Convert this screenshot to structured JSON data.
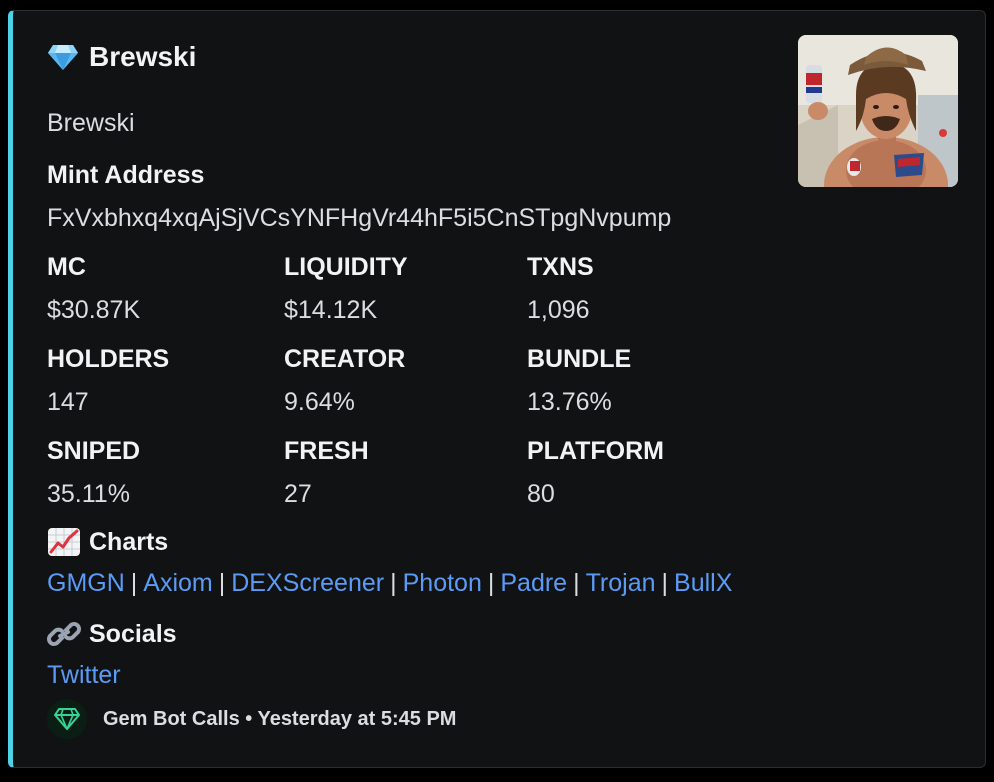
{
  "embed": {
    "accent_color": "#4fd1e8",
    "title_icon": "gem-icon",
    "title": "Brewski",
    "subtitle": "Brewski",
    "mint": {
      "label": "Mint Address",
      "value": "FxVxbhxq4xqAjSjVCsYNFHgVr44hF5i5CnSTpgNvpump"
    },
    "stats": [
      {
        "label": "MC",
        "value": "$30.87K"
      },
      {
        "label": "LIQUIDITY",
        "value": "$14.12K"
      },
      {
        "label": "TXNS",
        "value": "1,096"
      },
      {
        "label": "HOLDERS",
        "value": "147"
      },
      {
        "label": "CREATOR",
        "value": "9.64%"
      },
      {
        "label": "BUNDLE",
        "value": "13.76%"
      },
      {
        "label": "SNIPED",
        "value": "35.11%"
      },
      {
        "label": "FRESH",
        "value": "27"
      },
      {
        "label": "PLATFORM",
        "value": "80"
      }
    ],
    "charts": {
      "icon": "chart-increasing-icon",
      "title": "Charts",
      "separator": "|",
      "links": [
        "GMGN",
        "Axiom",
        "DEXScreener",
        "Photon",
        "Padre",
        "Trojan",
        "BullX"
      ]
    },
    "socials": {
      "icon": "link-icon",
      "title": "Socials",
      "links": [
        "Twitter"
      ]
    },
    "thumbnail": {
      "icon": "token-image"
    },
    "link_color": "#5b9bf5",
    "footer": {
      "icon": "gem-bot-avatar-icon",
      "text": "Gem Bot Calls • Yesterday at 5:45 PM"
    }
  }
}
